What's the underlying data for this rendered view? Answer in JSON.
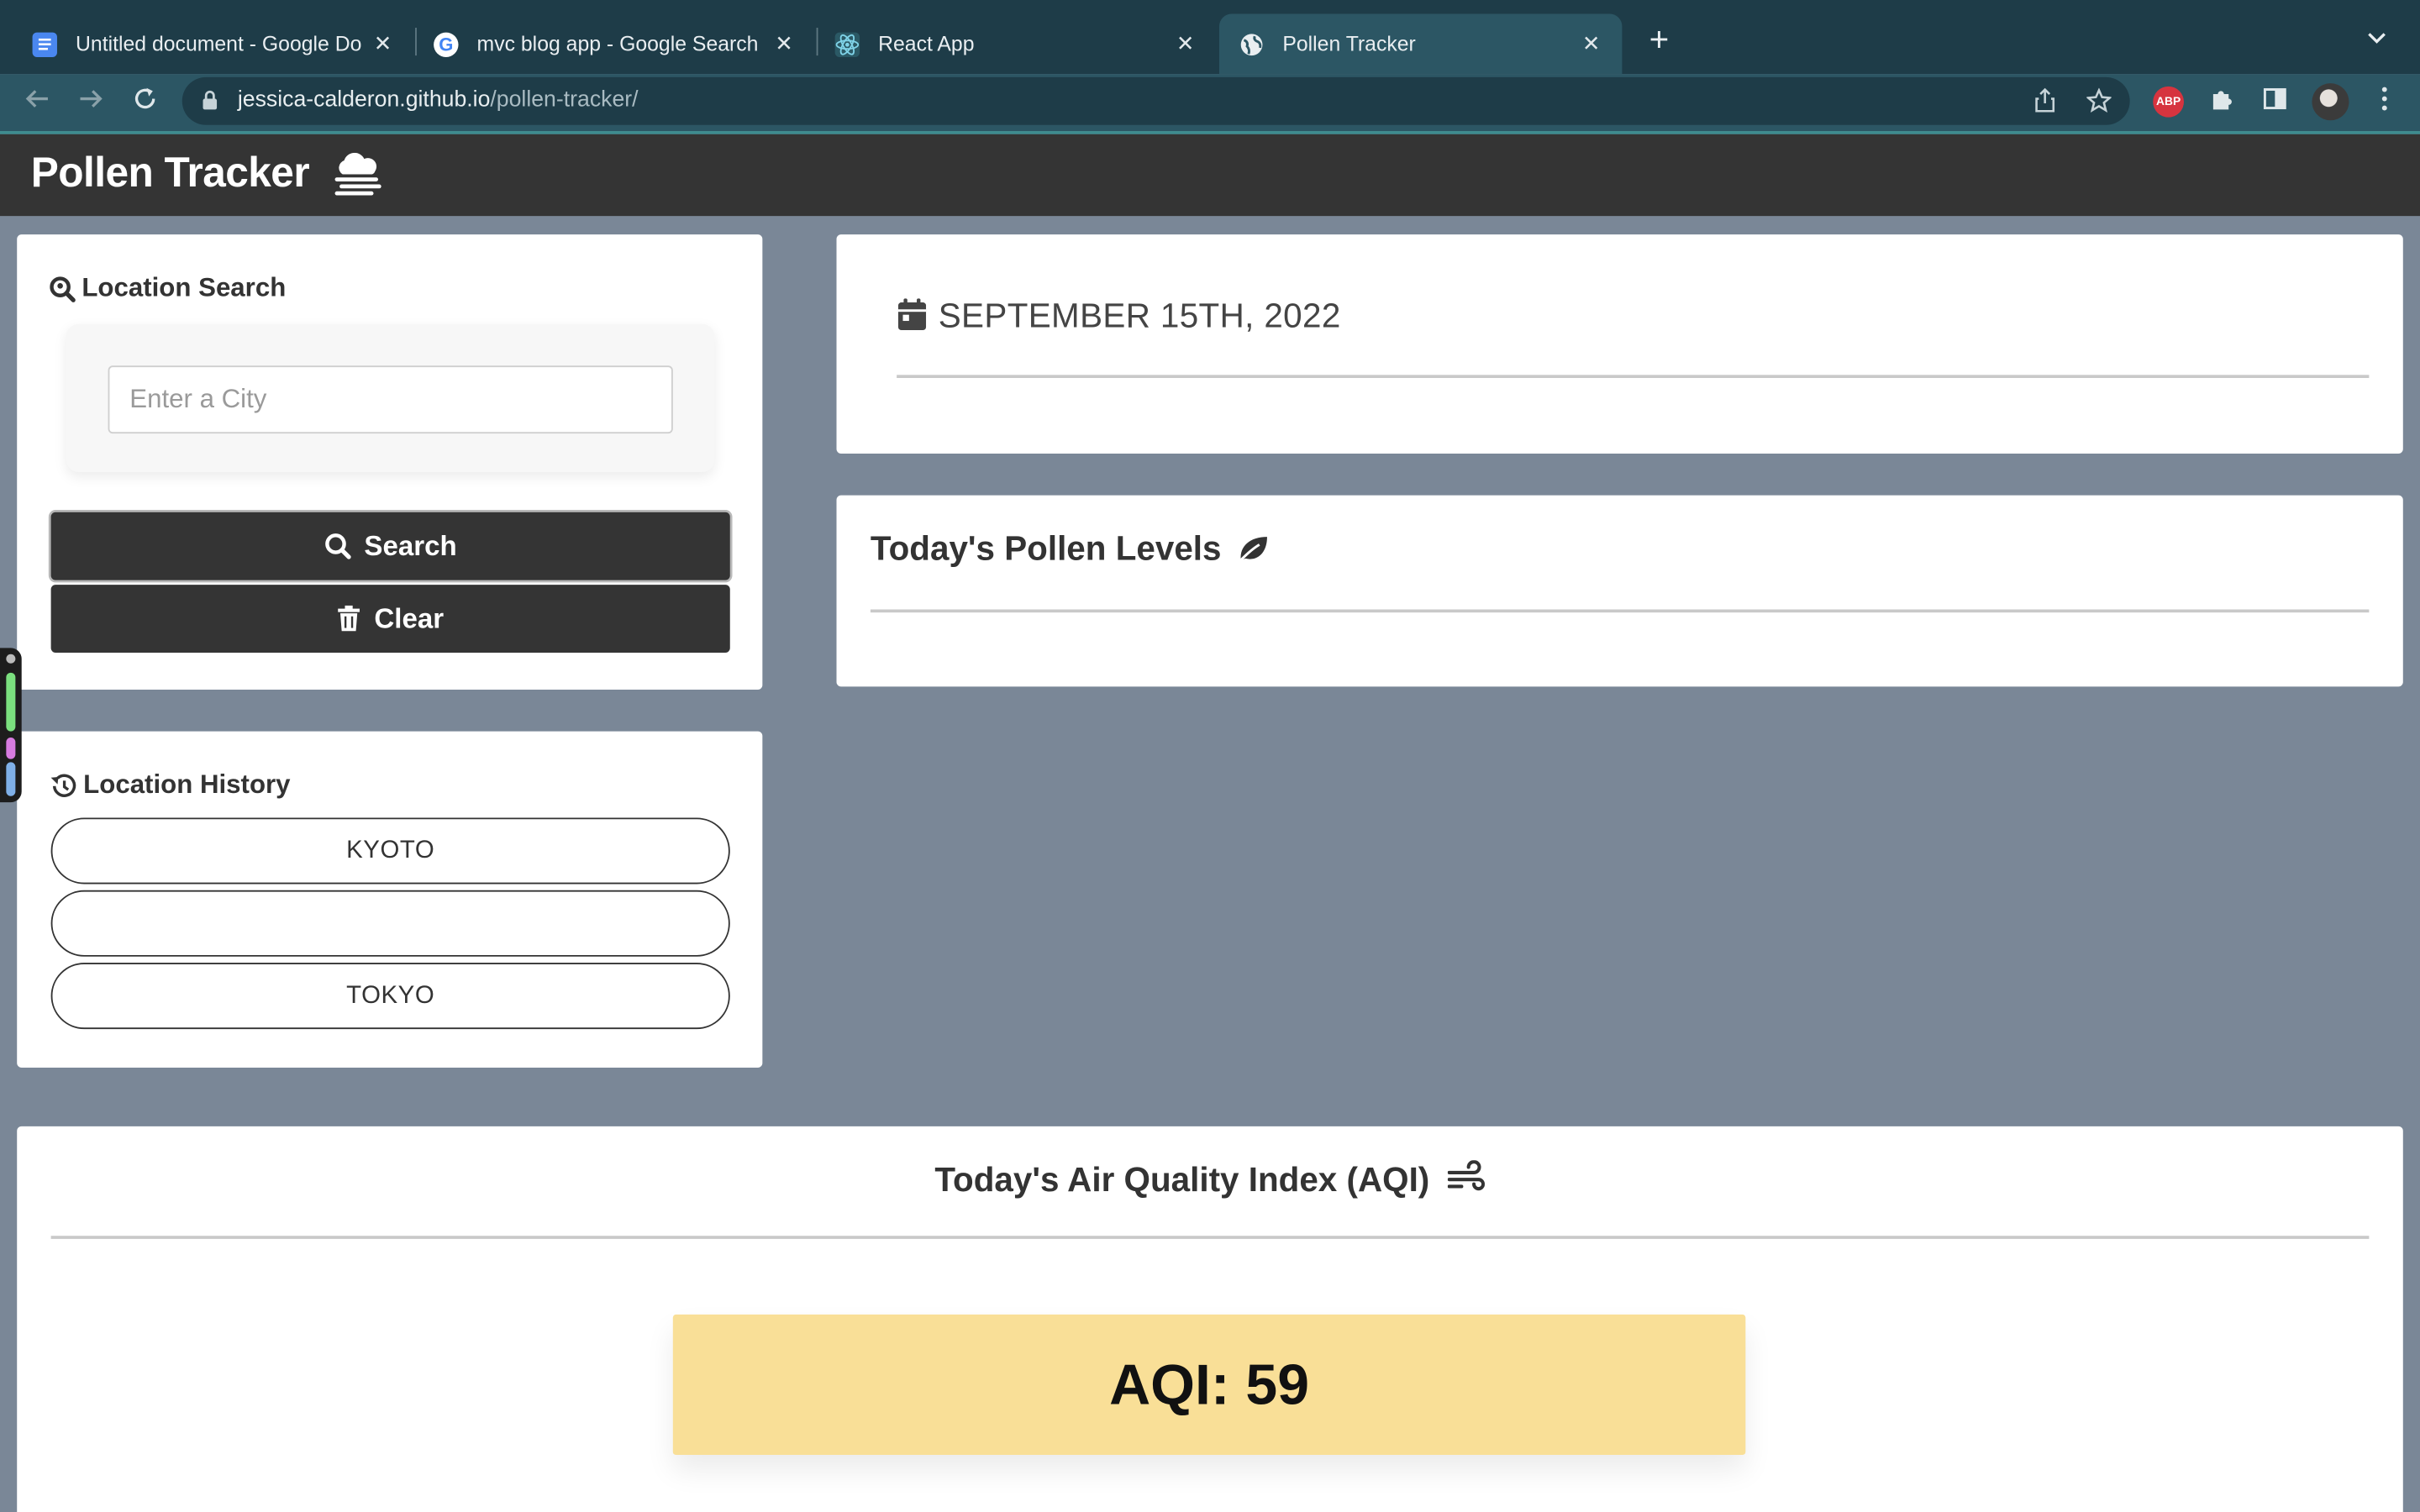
{
  "browser": {
    "tabs": [
      {
        "title": "Untitled document - Google Do",
        "icon": "google-docs-icon"
      },
      {
        "title": "mvc blog app - Google Search",
        "icon": "google-icon"
      },
      {
        "title": "React App",
        "icon": "react-icon"
      },
      {
        "title": "Pollen Tracker",
        "icon": "globe-icon",
        "active": true
      }
    ],
    "url_host": "jessica-calderon.github.io",
    "url_path": "/pollen-tracker/",
    "extensions": [
      "share-icon",
      "star-icon",
      "adblock-icon",
      "puzzle-icon",
      "sidepanel-icon",
      "profile-avatar",
      "menu-icon"
    ],
    "abp_label": "ABP",
    "accent_color": "#3d8c8f"
  },
  "navbar": {
    "brand": "Pollen Tracker",
    "brand_icon": "cloud-icon"
  },
  "search_card": {
    "title": "Location Search",
    "input_placeholder": "Enter a City",
    "input_value": "",
    "search_label": "Search",
    "clear_label": "Clear"
  },
  "history_card": {
    "title": "Location History",
    "items": [
      "KYOTO",
      "",
      "TOKYO"
    ]
  },
  "date_card": {
    "date": "SEPTEMBER 15TH, 2022"
  },
  "pollen_card": {
    "title": "Today's Pollen Levels"
  },
  "aqi_card": {
    "title": "Today's Air Quality Index (AQI)",
    "aqi_label": "AQI: 59",
    "aqi_value": 59,
    "aqi_color": "#f9df97"
  },
  "colors": {
    "page_bg": "#7a8797",
    "navbar_bg": "#343434",
    "button_bg": "#343434"
  }
}
